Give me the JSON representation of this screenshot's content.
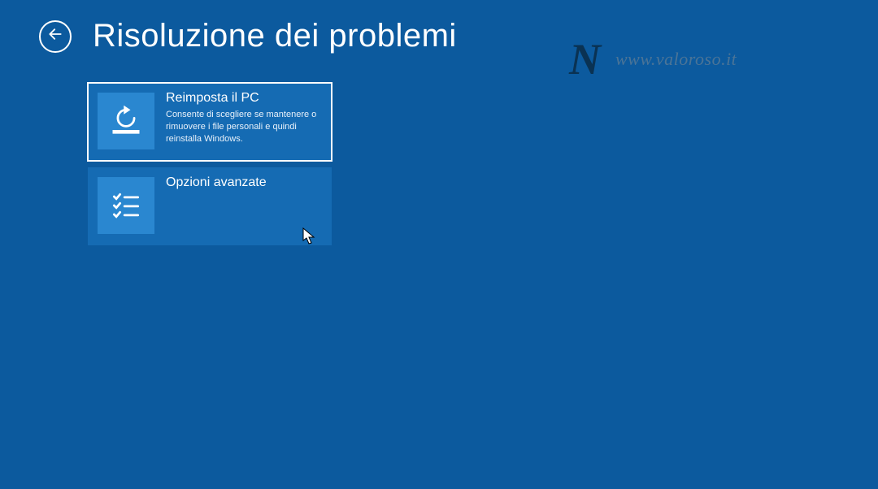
{
  "header": {
    "title": "Risoluzione dei problemi"
  },
  "tiles": [
    {
      "title": "Reimposta il PC",
      "description": "Consente di scegliere se mantenere o rimuovere i file personali e quindi reinstalla Windows."
    },
    {
      "title": "Opzioni avanzate",
      "description": ""
    }
  ],
  "watermark": {
    "logo": "N",
    "url": "www.valoroso.it"
  }
}
